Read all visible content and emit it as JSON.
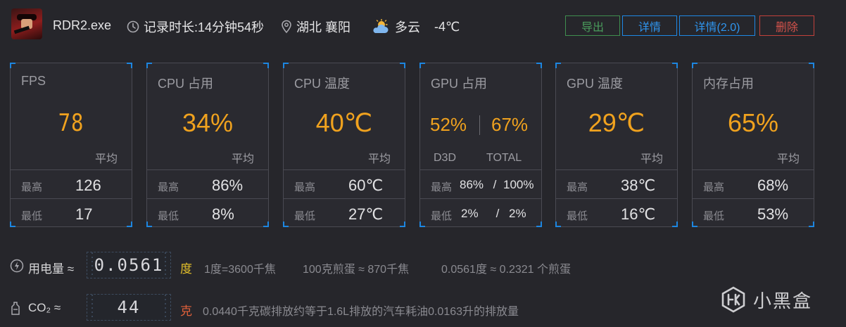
{
  "header": {
    "app_name": "RDR2.exe",
    "record_duration": "记录时长:14分钟54秒",
    "location": "湖北 襄阳",
    "weather": "多云",
    "temperature": "-4℃",
    "buttons": {
      "export": "导出",
      "detail": "详情",
      "detail2": "详情(2.0)",
      "delete": "删除"
    }
  },
  "labels": {
    "avg": "平均",
    "max": "最高",
    "min": "最低"
  },
  "cards": {
    "fps": {
      "title": "FPS",
      "avg": "78",
      "max": "126",
      "min": "17"
    },
    "cpu_usage": {
      "title": "CPU 占用",
      "avg": "34%",
      "max": "86%",
      "min": "8%"
    },
    "cpu_temp": {
      "title": "CPU 温度",
      "avg": "40℃",
      "max": "60℃",
      "min": "27℃"
    },
    "gpu_usage": {
      "title": "GPU 占用",
      "d3d_avg": "52%",
      "total_avg": "67%",
      "d3d_label": "D3D",
      "total_label": "TOTAL",
      "max_d3d": "86%",
      "max_total": "100%",
      "min_d3d": "2%",
      "min_total": "2%",
      "slash": "/"
    },
    "gpu_temp": {
      "title": "GPU 温度",
      "avg": "29℃",
      "max": "38℃",
      "min": "16℃"
    },
    "mem_usage": {
      "title": "内存占用",
      "avg": "65%",
      "max": "68%",
      "min": "53%"
    }
  },
  "power": {
    "label": "用电量 ≈",
    "value": "0.0561",
    "unit": "度",
    "note1": "1度=3600千焦",
    "note2": "100克煎蛋 ≈ 870千焦",
    "note3": "0.0561度 ≈ 0.2321 个煎蛋"
  },
  "co2": {
    "label": "CO₂ ≈",
    "value": "44",
    "unit": "克",
    "note": "0.0440千克碳排放约等于1.6L排放的汽车耗油0.0163升的排放量"
  },
  "watermark": "小黑盒",
  "colors": {
    "accent": "#f0a21e",
    "blue": "#1d86e0",
    "export_green": "#4a9d5c",
    "delete_red": "#d2524b"
  }
}
